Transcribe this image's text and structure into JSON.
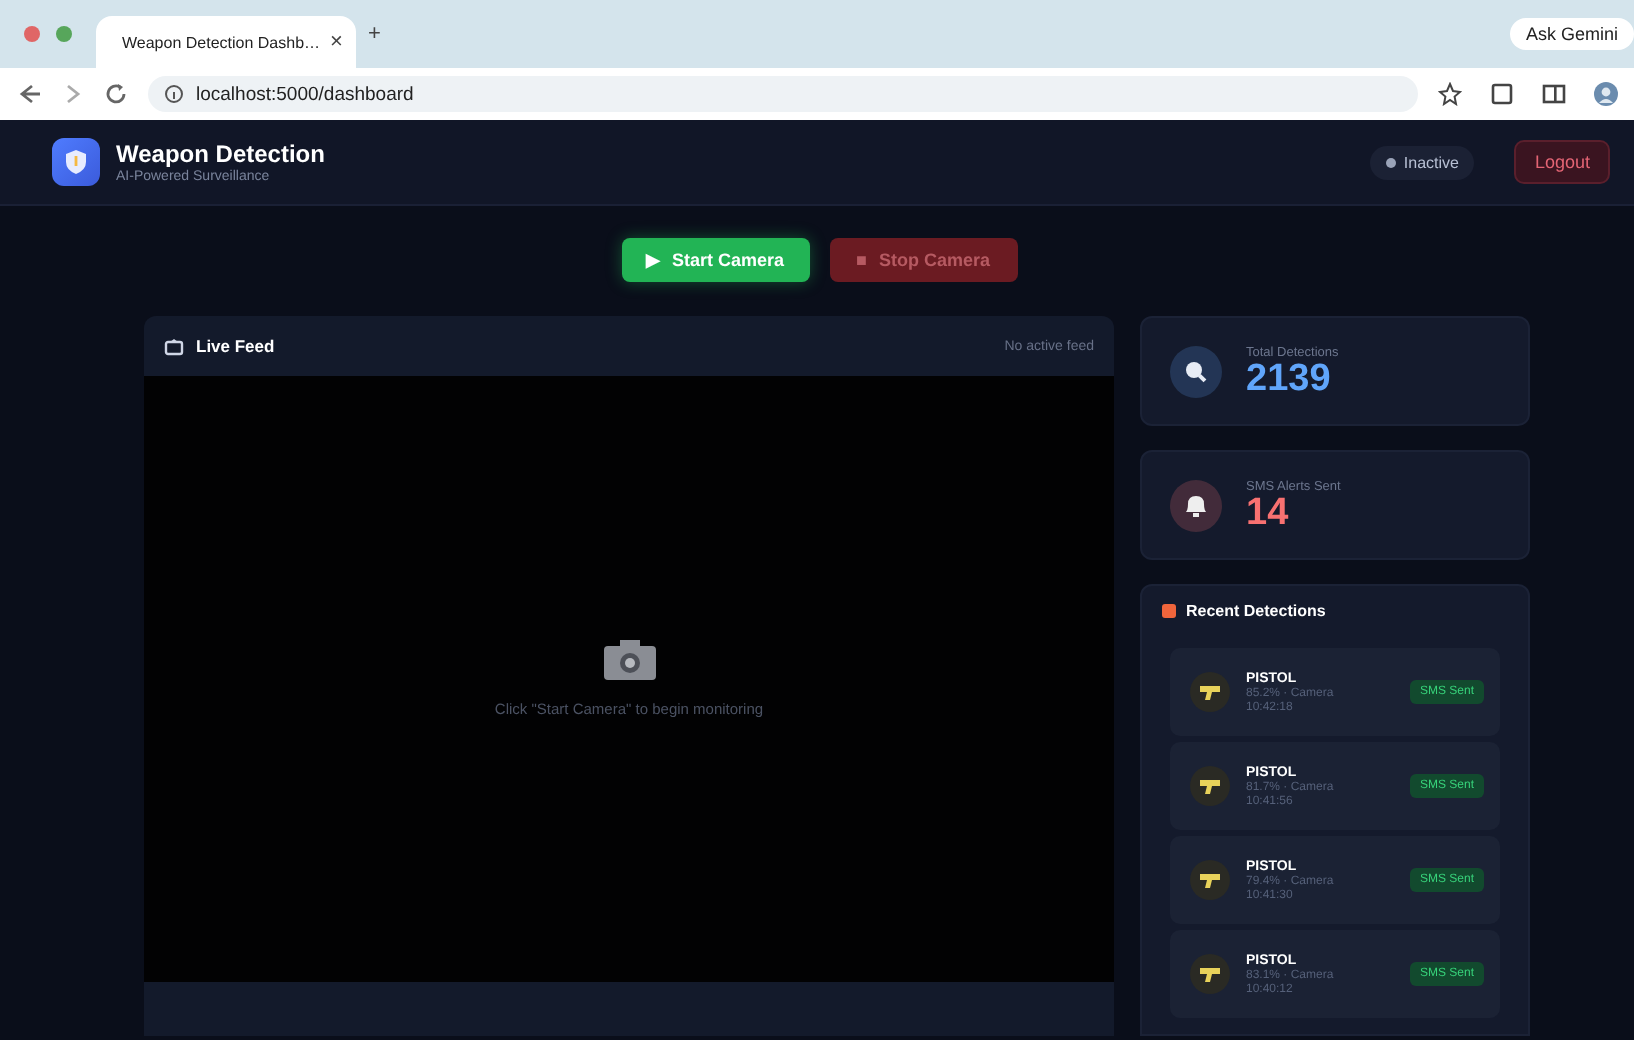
{
  "browser": {
    "tab_title": "Weapon Detection Dashb…",
    "tab_close": "×",
    "new_tab": "+",
    "right_chip": "Ask Gemini",
    "url": "localhost:5000/dashboard"
  },
  "header": {
    "title": "Weapon Detection",
    "subtitle": "AI-Powered Surveillance",
    "status": "Inactive",
    "logout": "Logout"
  },
  "controls": [
    {
      "icon": "▶",
      "label": "Start Camera",
      "disabled": false
    },
    {
      "icon": "■",
      "label": "Stop Camera",
      "disabled": true
    }
  ],
  "live_feed": {
    "title": "Live Feed",
    "status": "No active feed",
    "hint": "Click \"Start Camera\" to begin monitoring"
  },
  "stats": [
    {
      "kind": "search",
      "label": "Total Detections",
      "value": "2139",
      "color": "#60a5fa"
    },
    {
      "kind": "bell",
      "label": "SMS Alerts Sent",
      "value": "14",
      "color": "#f87171"
    }
  ],
  "recent": {
    "title": "Recent Detections",
    "items": [
      {
        "label": "PISTOL",
        "detail": "85.2% · Camera",
        "time": "10:42:18",
        "badge": "SMS Sent"
      },
      {
        "label": "PISTOL",
        "detail": "81.7% · Camera",
        "time": "10:41:56",
        "badge": "SMS Sent"
      },
      {
        "label": "PISTOL",
        "detail": "79.4% · Camera",
        "time": "10:41:30",
        "badge": "SMS Sent"
      },
      {
        "label": "PISTOL",
        "detail": "83.1% · Camera",
        "time": "10:40:12",
        "badge": "SMS Sent"
      }
    ]
  }
}
